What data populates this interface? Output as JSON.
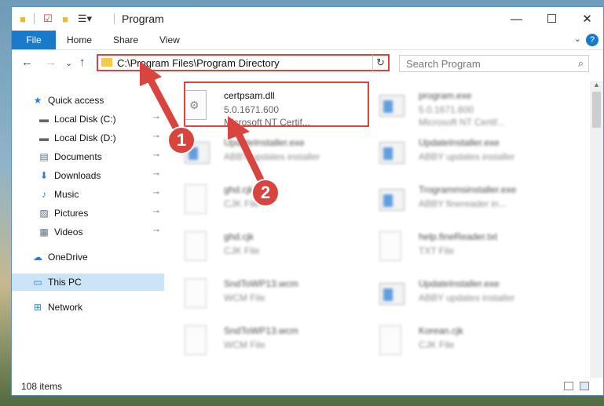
{
  "window": {
    "title": "Program",
    "minimize": "—",
    "maximize": "☐",
    "close": "✕"
  },
  "ribbon": {
    "file": "File",
    "home": "Home",
    "share": "Share",
    "view": "View",
    "expand": "⌄",
    "help": "?"
  },
  "nav": {
    "back": "←",
    "forward": "→",
    "recent": "⌄",
    "up": "↑",
    "address": "C:\\Program Files\\Program Directory",
    "address_dropdown": "⌄",
    "refresh": "↻",
    "search_placeholder": "Search Program",
    "search_icon": "⌕"
  },
  "sidebar": {
    "items": [
      {
        "label": "Quick access",
        "icon": "star-icon",
        "glyph": "★",
        "color": "#2a7fd4",
        "pinned": false,
        "indent": 0
      },
      {
        "label": "Local Disk (C:)",
        "icon": "drive-icon",
        "glyph": "▬",
        "color": "#666666",
        "pinned": true,
        "indent": 1
      },
      {
        "label": "Local Disk (D:)",
        "icon": "drive-icon",
        "glyph": "▬",
        "color": "#666666",
        "pinned": true,
        "indent": 1
      },
      {
        "label": "Documents",
        "icon": "documents-icon",
        "glyph": "▤",
        "color": "#5a6b80",
        "pinned": true,
        "indent": 1
      },
      {
        "label": "Downloads",
        "icon": "download-icon",
        "glyph": "⬇",
        "color": "#2a7fd4",
        "pinned": true,
        "indent": 1
      },
      {
        "label": "Music",
        "icon": "music-icon",
        "glyph": "♪",
        "color": "#2a7fd4",
        "pinned": true,
        "indent": 1
      },
      {
        "label": "Pictures",
        "icon": "pictures-icon",
        "glyph": "▨",
        "color": "#5a6b80",
        "pinned": true,
        "indent": 1
      },
      {
        "label": "Videos",
        "icon": "videos-icon",
        "glyph": "▦",
        "color": "#5a6b80",
        "pinned": true,
        "indent": 1
      },
      {
        "label": "OneDrive",
        "icon": "cloud-icon",
        "glyph": "☁",
        "color": "#2a7fd4",
        "pinned": false,
        "indent": 0
      },
      {
        "label": "This PC",
        "icon": "computer-icon",
        "glyph": "▭",
        "color": "#2a7fd4",
        "pinned": false,
        "indent": 0,
        "selected": true
      },
      {
        "label": "Network",
        "icon": "network-icon",
        "glyph": "⊞",
        "color": "#2a7fd4",
        "pinned": false,
        "indent": 0
      }
    ],
    "pin_glyph": "📌"
  },
  "files": [
    {
      "name": "certpsam.dll",
      "l2": "5.0.1671.600",
      "l3": "Microsoft NT Certif...",
      "kind": "dll",
      "highlight": true
    },
    {
      "name": "program.exe",
      "l2": "5.0.1671.600",
      "l3": "Microsoft NT Certif...",
      "kind": "exe"
    },
    {
      "name": "UpdateInstaller.exe",
      "l2": "ABBY updates installer",
      "l3": "",
      "kind": "exe"
    },
    {
      "name": "UpdateInstaller.exe",
      "l2": "ABBY updates installer",
      "l3": "",
      "kind": "exe"
    },
    {
      "name": "ghd.cjk",
      "l2": "CJK File",
      "l3": "",
      "kind": "doc"
    },
    {
      "name": "Trogrammsinstaller.exe",
      "l2": "ABBY finereader in...",
      "l3": "",
      "kind": "exe"
    },
    {
      "name": "ghd.cjk",
      "l2": "CJK File",
      "l3": "",
      "kind": "doc"
    },
    {
      "name": "help.fineReader.txt",
      "l2": "TXT File",
      "l3": "",
      "kind": "doc"
    },
    {
      "name": "SndToWP13.wcm",
      "l2": "WCM File",
      "l3": "",
      "kind": "doc"
    },
    {
      "name": "UpdateInstaller.exe",
      "l2": "ABBY updates installer",
      "l3": "",
      "kind": "exe"
    },
    {
      "name": "SndToWP13.wcm",
      "l2": "WCM File",
      "l3": "",
      "kind": "doc"
    },
    {
      "name": "Korean.cjk",
      "l2": "CJK File",
      "l3": "",
      "kind": "doc"
    }
  ],
  "status": {
    "count": "108 items"
  },
  "markers": {
    "one": "1",
    "two": "2"
  },
  "colors": {
    "accent": "#1979ca",
    "highlight": "#d9443f",
    "selection": "#cce4f7"
  }
}
